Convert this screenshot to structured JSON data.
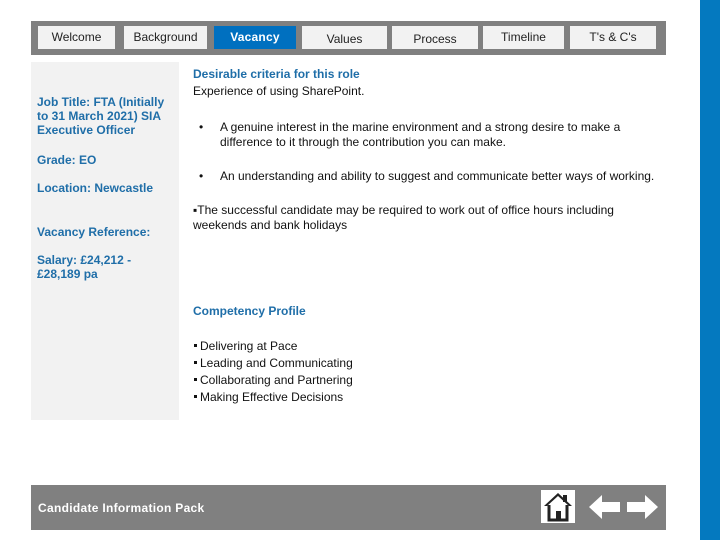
{
  "nav": {
    "tabs": [
      {
        "label": "Welcome",
        "active": false
      },
      {
        "label": "Background",
        "active": false
      },
      {
        "label": "Vacancy",
        "active": true
      },
      {
        "label": "Values",
        "active": false
      },
      {
        "label": "Process",
        "active": false
      },
      {
        "label": "Timeline",
        "active": false
      },
      {
        "label": "T's & C's",
        "active": false
      }
    ]
  },
  "sidebar": {
    "job_title": "Job Title: FTA (Initially to 31 March 2021) SIA Executive Officer",
    "grade": "Grade: EO",
    "location": "Location: Newcastle",
    "vacancy_reference": "Vacancy Reference:",
    "salary": "Salary:  £24,212 - £28,189 pa"
  },
  "main": {
    "desirable_heading": "Desirable criteria for this role",
    "desirable_intro": "Experience of using SharePoint.",
    "desirable_bullets": [
      "A genuine interest in the marine environment and a strong desire to make a difference to it through the contribution you can make.",
      "An understanding and ability to suggest and communicate better ways of working."
    ],
    "bullet_glyph": "•",
    "hours_note": "▪The successful candidate may be required to work out of office hours including weekends and bank holidays",
    "competency_heading": "Competency Profile",
    "competencies": [
      "Delivering at Pace",
      "Leading and Communicating",
      "Collaborating and Partnering",
      "Making Effective Decisions"
    ]
  },
  "footer": {
    "title": "Candidate Information Pack",
    "icons": [
      "home-icon",
      "arrow-left-icon",
      "arrow-right-icon"
    ]
  },
  "colors": {
    "accent_blue": "#0070c0",
    "stripe_blue": "#0479bf",
    "heading_blue": "#1f6ea8",
    "bar_grey": "#808080",
    "panel_grey": "#f2f2f2"
  }
}
